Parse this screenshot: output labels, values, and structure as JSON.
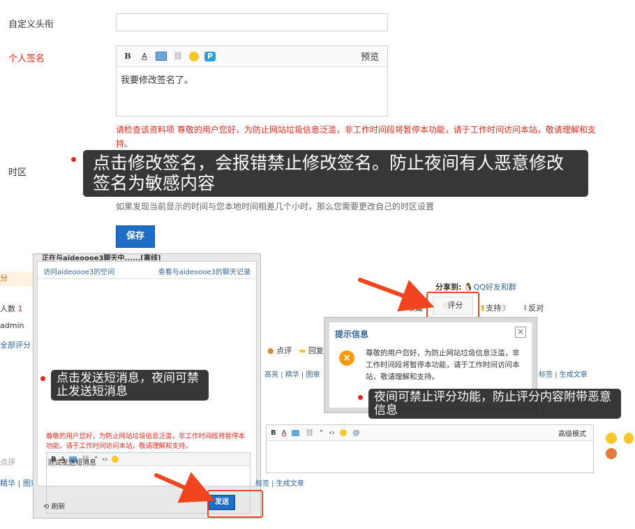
{
  "profile": {
    "custom_title_label": "自定义头衔",
    "signature_label": "个人签名",
    "signature_preview": "预览",
    "signature_value": "我要修改签名了。",
    "signature_error": "请检查该资料项 尊敬的用户您好，为防止网站垃圾信息泛滥，非工作时间段将暂停本功能，请于工作时间访问本站，敬请理解和支持。",
    "timezone_label": "时区",
    "timezone_partial": "如果发现当前显示的时间与您本地时间相差几个小时，那么您需要更改自己的时区设置",
    "save_button": "保存"
  },
  "annotations": {
    "signature_note": "点击修改签名，会报错禁止修改签名。防止夜间有人恶意修改签名为敏感内容",
    "message_note": "点击发送短消息，夜间可禁止发送短消息",
    "rating_note": "夜间可禁止评分功能，防止评分内容附带恶意信息"
  },
  "chat": {
    "header_status": "正在与aideoooe3聊天中......[离线]",
    "visit_space": "访问aideoooe3的空间",
    "view_history": "查看与aideoooe3的聊天记录",
    "error_text": "尊敬的用户您好，为防止网站垃圾信息泛滥，非工作时间段将暂停本功能，请于工作时间访问本站，敬请理解和支持。",
    "input_value": "测试发送短消息",
    "refresh_label": "刷新",
    "send_button": "发送"
  },
  "background_left": {
    "score_label": "分",
    "people_label": "人数",
    "people_count": "1",
    "admin_label": "admin",
    "all_score_link": "全部评分",
    "comment_label": "点评",
    "nav_partial": "精华 | 图章"
  },
  "post_actions": {
    "share_label": "分享到:",
    "share_target": "QQ好友和群",
    "collect_label": "收藏",
    "rate_label": "评分",
    "support_label": "支持",
    "support_count": "3",
    "oppose_label": "反对",
    "comment_label": "点评",
    "reply_partial": "回复"
  },
  "moderation_bar": {
    "left_links": "高亮 | 精华 | 图章",
    "right_links": "标签 | 生成文章",
    "bottom_right_links": "标签 | 生成文章"
  },
  "notice_dialog": {
    "title": "提示信息",
    "close_label": "×",
    "message": "尊敬的用户您好，为防止网站垃圾信息泛滥，非工作时间段将暂停本功能，请于工作时间访问本站，敬请理解和支持。"
  },
  "reply_editor": {
    "advanced_mode": "高级模式"
  },
  "colors": {
    "accent_blue": "#1e6ec5",
    "error_red": "#e4281c",
    "highlight_orange": "#f0451f",
    "tooltip_bg": "#262626"
  }
}
